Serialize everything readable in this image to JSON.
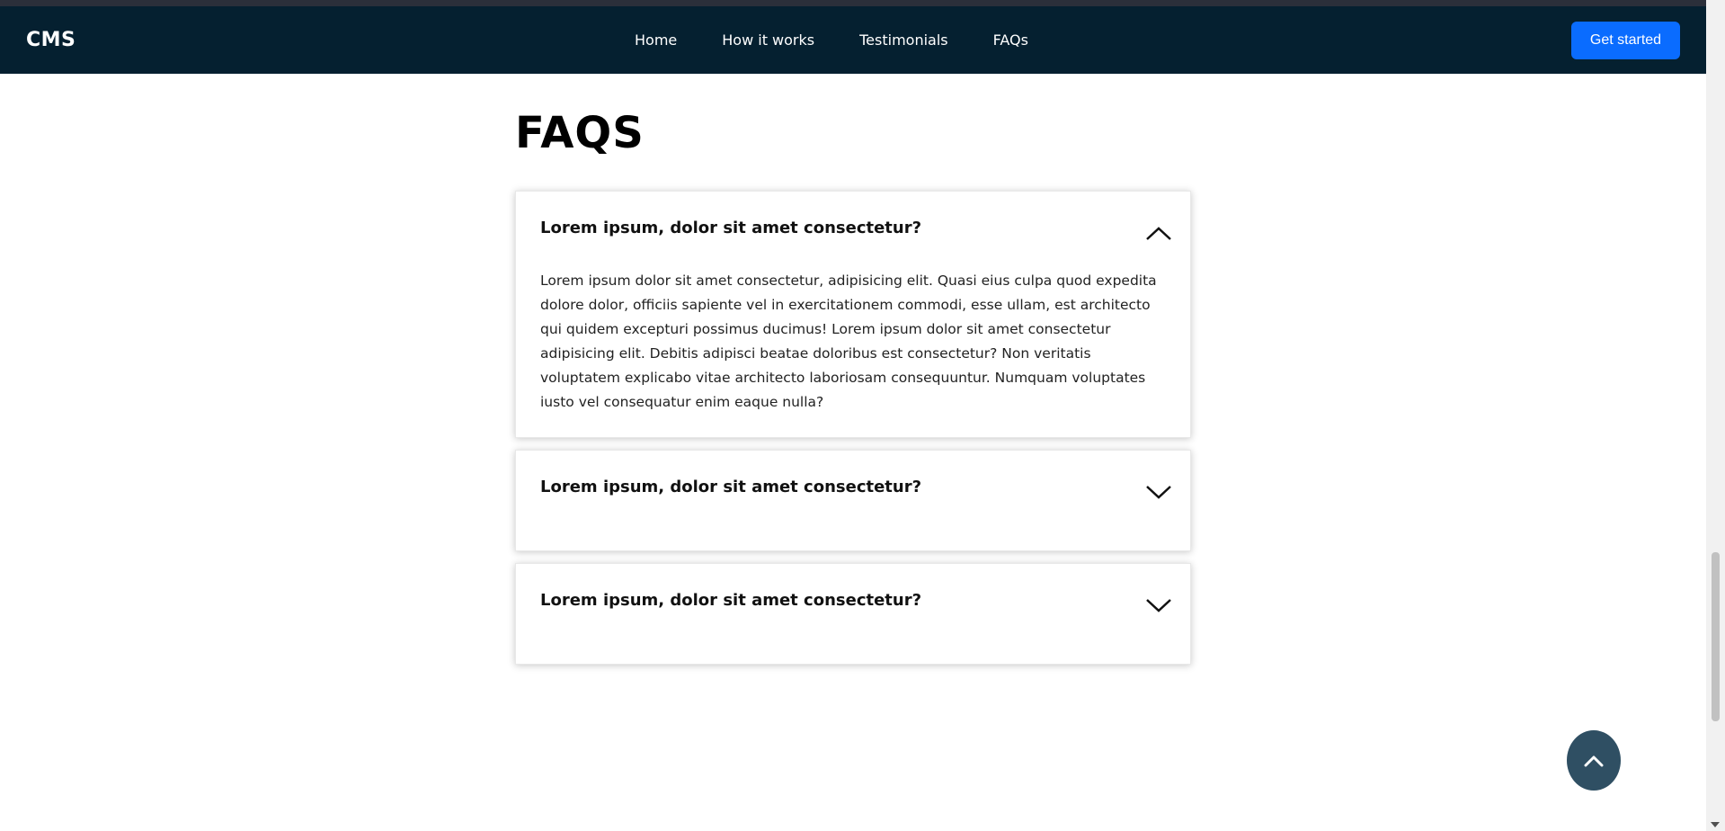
{
  "navbar": {
    "brand": "CMS",
    "links": [
      "Home",
      "How it works",
      "Testimonials",
      "FAQs"
    ],
    "cta_label": "Get started",
    "background": "#052030",
    "cta_color": "#0a6cff"
  },
  "faq": {
    "title": "FAQS",
    "items": [
      {
        "question": "Lorem ipsum, dolor sit amet consectetur?",
        "expanded": true,
        "answer": "Lorem ipsum dolor sit amet consectetur, adipisicing elit. Quasi eius culpa quod expedita dolore dolor, officiis sapiente vel in exercitationem commodi, esse ullam, est architecto qui quidem excepturi possimus ducimus! Lorem ipsum dolor sit amet consectetur adipisicing elit. Debitis adipisci beatae doloribus est consectetur? Non veritatis voluptatem explicabo vitae architecto laboriosam consequuntur. Numquam voluptates iusto vel consequatur enim eaque nulla?"
      },
      {
        "question": "Lorem ipsum, dolor sit amet consectetur?",
        "expanded": false
      },
      {
        "question": "Lorem ipsum, dolor sit amet consectetur?",
        "expanded": false
      }
    ]
  },
  "icons": {
    "collapse": "chevron-up-icon",
    "expand": "chevron-down-icon",
    "back_to_top": "chevron-up-icon"
  },
  "back_to_top_color": "#2f4f63"
}
